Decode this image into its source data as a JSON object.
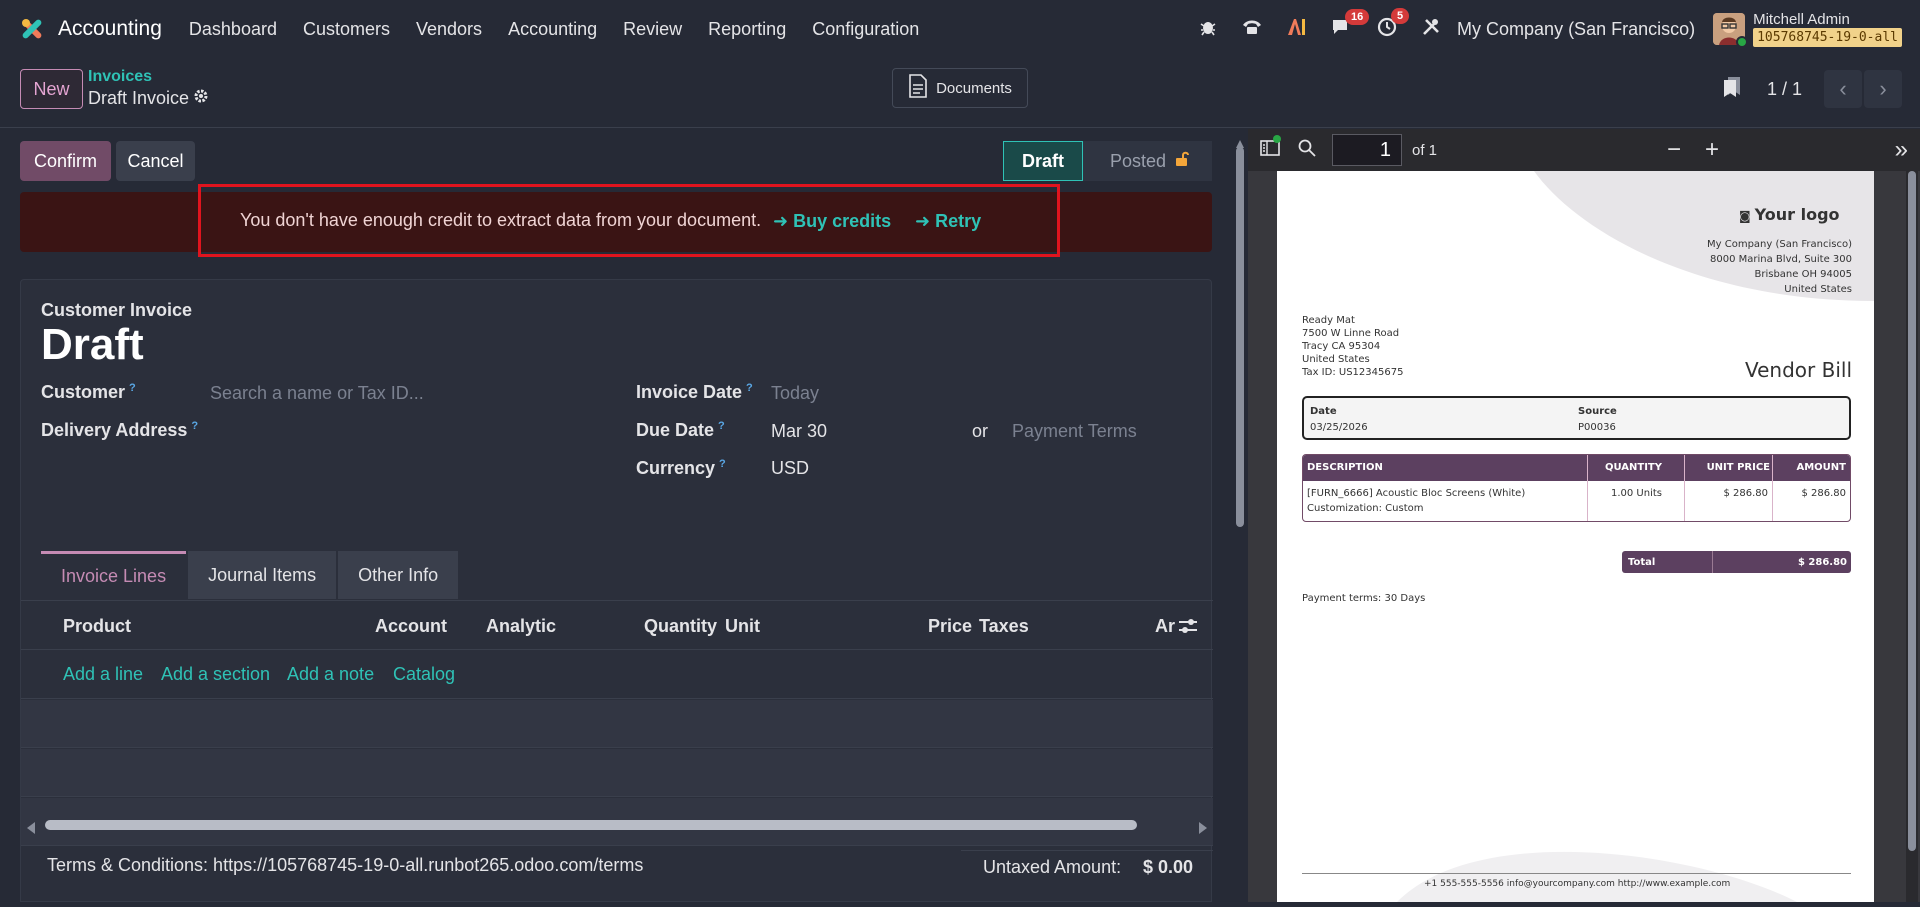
{
  "nav": {
    "app_title": "Accounting",
    "menu": [
      "Dashboard",
      "Customers",
      "Vendors",
      "Accounting",
      "Review",
      "Reporting",
      "Configuration"
    ],
    "messages_badge": "16",
    "activity_badge": "5",
    "company": "My Company (San Francisco)",
    "user_name": "Mitchell Admin",
    "database": "105768745-19-0-all"
  },
  "control": {
    "new_label": "New",
    "breadcrumb_parent": "Invoices",
    "breadcrumb_current": "Draft Invoice",
    "documents_label": "Documents",
    "pager": "1 / 1"
  },
  "actions": {
    "confirm": "Confirm",
    "cancel": "Cancel"
  },
  "status": {
    "draft": "Draft",
    "posted": "Posted"
  },
  "alert": {
    "message": "You don't have enough credit to extract data from your document.",
    "buy_credits": "➜ Buy credits",
    "retry": "➜ Retry"
  },
  "form": {
    "move_type": "Customer Invoice",
    "name": "Draft",
    "customer_label": "Customer",
    "customer_placeholder": "Search a name or Tax ID...",
    "delivery_label": "Delivery Address",
    "invoice_date_label": "Invoice Date",
    "invoice_date_placeholder": "Today",
    "due_date_label": "Due Date",
    "due_date_value": "Mar 30",
    "or": "or",
    "payment_terms_placeholder": "Payment Terms",
    "currency_label": "Currency",
    "currency_value": "USD"
  },
  "tabs": [
    "Invoice Lines",
    "Journal Items",
    "Other Info"
  ],
  "lines": {
    "columns": [
      "Product",
      "Account",
      "Analytic",
      "Quantity",
      "Unit",
      "Price",
      "Taxes",
      "Ar"
    ],
    "add_links": [
      "Add a line",
      "Add a section",
      "Add a note",
      "Catalog"
    ]
  },
  "footer": {
    "terms": "Terms & Conditions: https://105768745-19-0-all.runbot265.odoo.com/terms",
    "untaxed_label": "Untaxed Amount:",
    "untaxed_value": "$ 0.00"
  },
  "pdf": {
    "page_input": "1",
    "page_of": "of 1",
    "your_logo": "Your logo",
    "company_addr": [
      "My Company (San Francisco)",
      "8000 Marina Blvd, Suite 300",
      "Brisbane OH 94005",
      "United States"
    ],
    "partner_addr": [
      "Ready Mat",
      "7500 W Linne Road",
      "Tracy CA 95304",
      "United States",
      "Tax ID: US12345675"
    ],
    "doc_title": "Vendor Bill",
    "date_label": "Date",
    "date_value": "03/25/2026",
    "source_label": "Source",
    "source_value": "P00036",
    "table_headers": [
      "DESCRIPTION",
      "QUANTITY",
      "UNIT PRICE",
      "AMOUNT"
    ],
    "line_desc1": "[FURN_6666] Acoustic Bloc Screens (White)",
    "line_desc2": "Customization: Custom",
    "line_qty": "1.00 Units",
    "line_price": "$ 286.80",
    "line_amount": "$ 286.80",
    "total_label": "Total",
    "total_value": "$ 286.80",
    "payment_terms": "Payment terms: 30 Days",
    "footer": "+1 555-555-5556 info@yourcompany.com http://www.example.com"
  },
  "colors": {
    "accent": "#2fc2b6",
    "primary": "#714b67",
    "alert_border": "#e0141e"
  }
}
